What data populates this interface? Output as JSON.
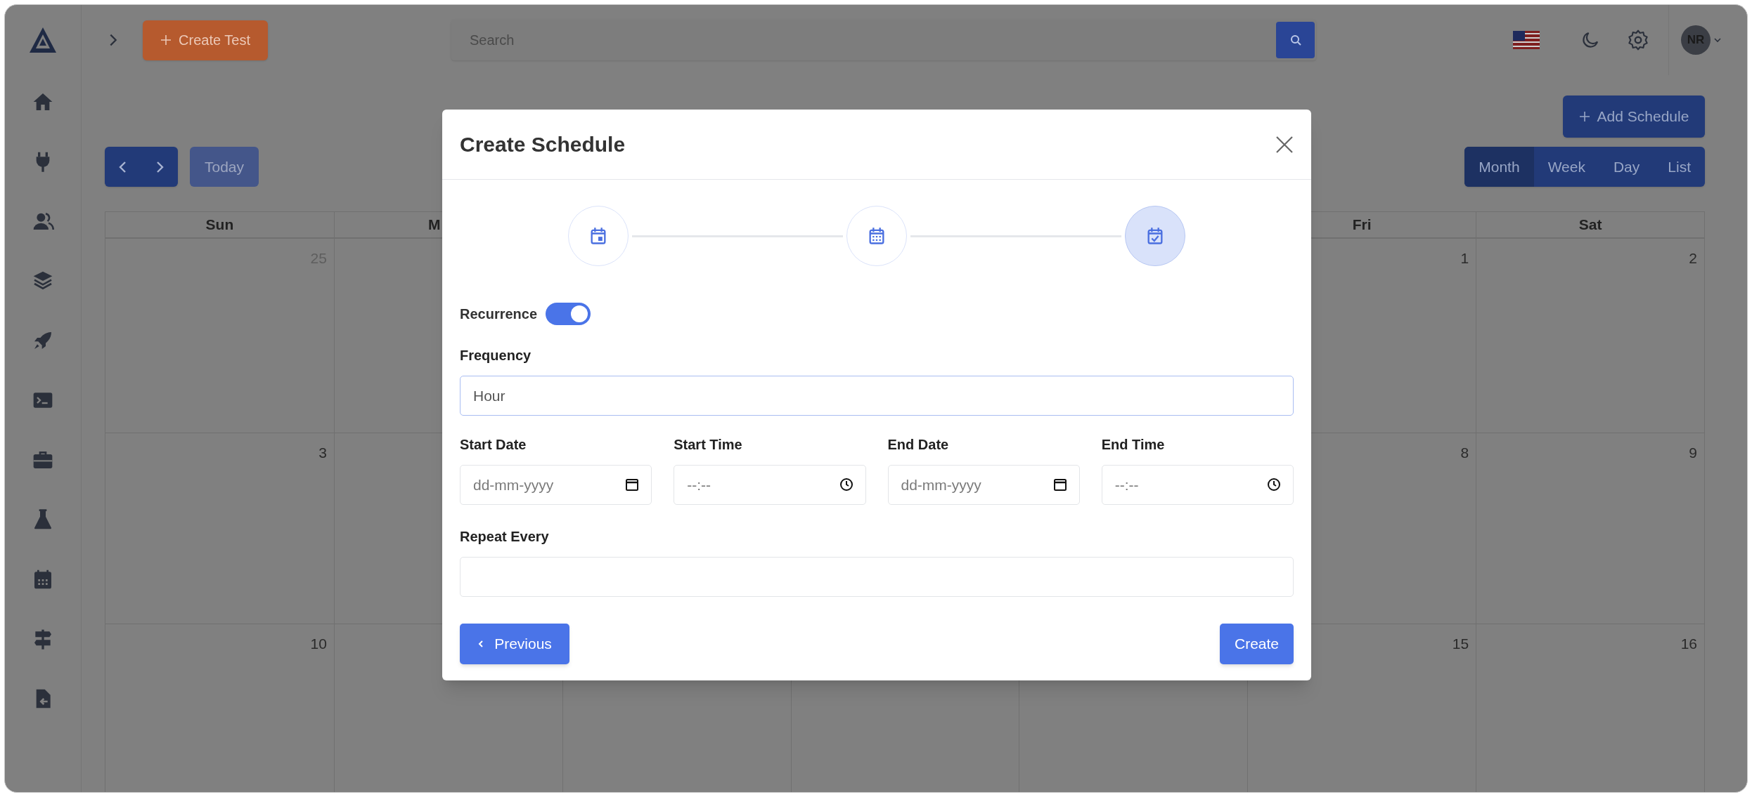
{
  "topbar": {
    "create_button": "Create Test",
    "search": {
      "placeholder": "Search"
    },
    "avatar": "NR"
  },
  "toolbar": {
    "add_button": "Add Schedule",
    "today_button": "Today",
    "views": [
      {
        "label": "Month",
        "selected": true
      },
      {
        "label": "Week",
        "selected": false
      },
      {
        "label": "Day",
        "selected": false
      },
      {
        "label": "List",
        "selected": false
      }
    ]
  },
  "calendar": {
    "headers": {
      "sun": "Sun",
      "mon": "M",
      "fri": "Fri",
      "sat": "Sat"
    },
    "weeks": [
      {
        "sun": {
          "date": "25",
          "muted": true
        },
        "fri": {
          "date": "1",
          "muted": false
        },
        "sat": {
          "date": "2",
          "muted": false
        }
      },
      {
        "sun": {
          "date": "3",
          "muted": false
        },
        "fri": {
          "date": "8",
          "muted": false
        },
        "sat": {
          "date": "9",
          "muted": false
        }
      },
      {
        "sun": {
          "date": "10",
          "muted": false
        },
        "fri": {
          "date": "15",
          "muted": false
        },
        "sat": {
          "date": "16",
          "muted": false
        }
      }
    ]
  },
  "modal": {
    "title": "Create Schedule",
    "steps": [
      {
        "selected": false
      },
      {
        "selected": false
      },
      {
        "selected": true
      }
    ],
    "recurrence": {
      "label": "Recurrence",
      "on": true
    },
    "frequency": {
      "label": "Frequency",
      "value": "Hour"
    },
    "fields": [
      {
        "label": "Start Date",
        "kind": "date",
        "placeholder": "dd-mm-yyyy"
      },
      {
        "label": "Start Time",
        "kind": "time",
        "placeholder": "--:--"
      },
      {
        "label": "End Date",
        "kind": "date",
        "placeholder": "dd-mm-yyyy"
      },
      {
        "label": "End Time",
        "kind": "time",
        "placeholder": "--:--"
      }
    ],
    "repeat_every": {
      "label": "Repeat Every"
    },
    "buttons": {
      "previous": "Previous",
      "create": "Create"
    }
  }
}
